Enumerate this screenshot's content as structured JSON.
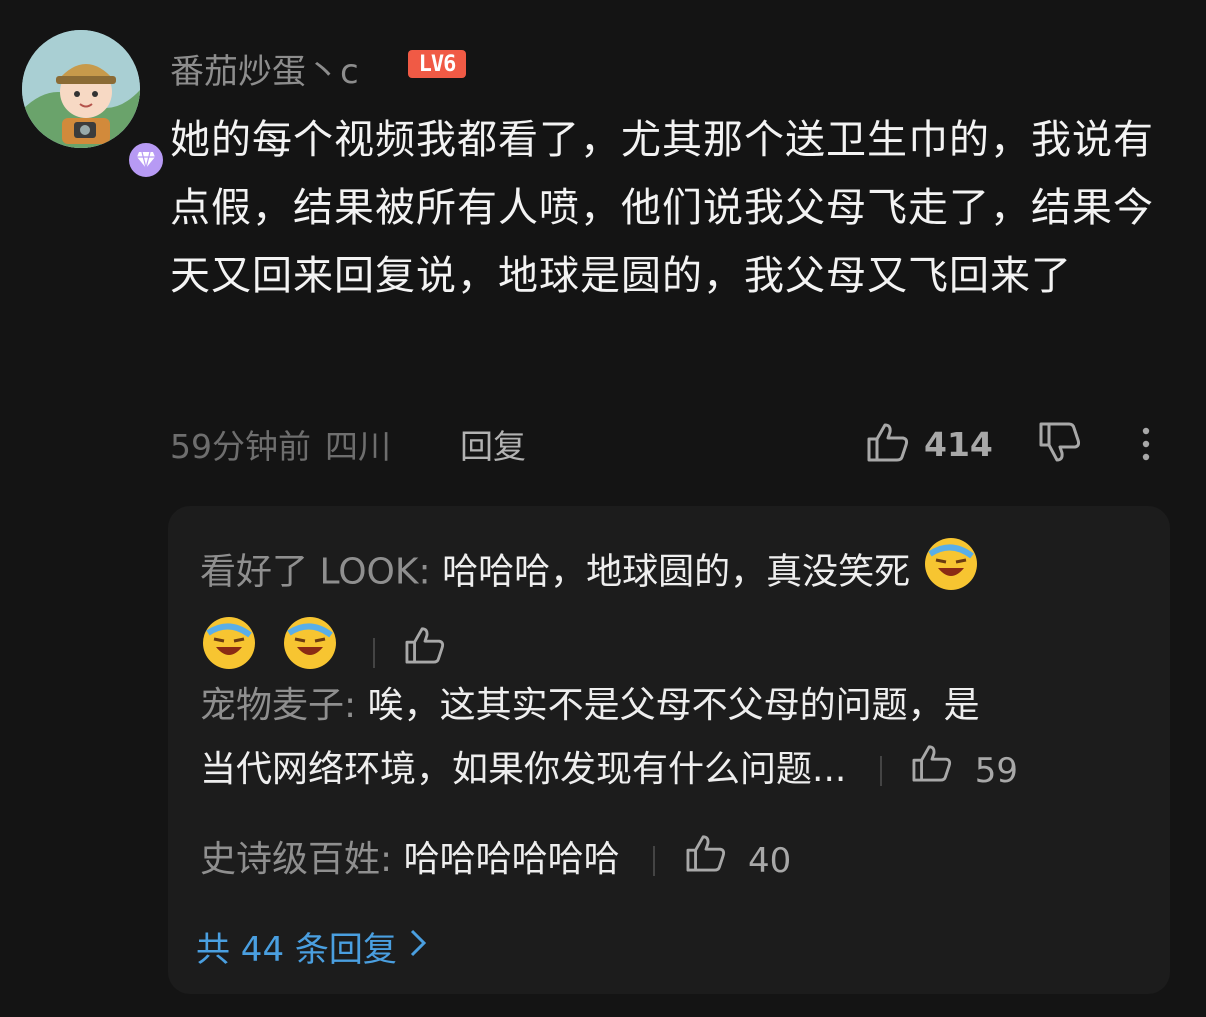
{
  "comment": {
    "username": "番茄炒蛋丶c",
    "level": "LV6",
    "text": "她的每个视频我都看了，尤其那个送卫生巾的，我说有点假，结果被所有人喷，他们说我父母飞走了，结果今天又回来回复说，地球是圆的，我父母又飞回来了",
    "time": "59分钟前",
    "location": "四川",
    "reply_label": "回复",
    "like_count": "414"
  },
  "replies": [
    {
      "user": "看好了 LOOK:",
      "text": "哈哈哈，地球圆的，真没笑死",
      "emoji": "laugh-cry-emoji",
      "like_count": ""
    },
    {
      "user": "宠物麦子:",
      "text_line1": "唉，这其实不是父母不父母的问题，是",
      "text_line2": "当代网络环境，如果你发现有什么问题...",
      "like_count": "59"
    },
    {
      "user": "史诗级百姓:",
      "text": "哈哈哈哈哈哈",
      "like_count": "40"
    }
  ],
  "more_replies_label": "共 44 条回复",
  "colors": {
    "background": "#141414",
    "reply_box": "#1c1c1c",
    "level_badge": "#f05a45",
    "link": "#4a9fe0",
    "vip": "#b79af4"
  }
}
